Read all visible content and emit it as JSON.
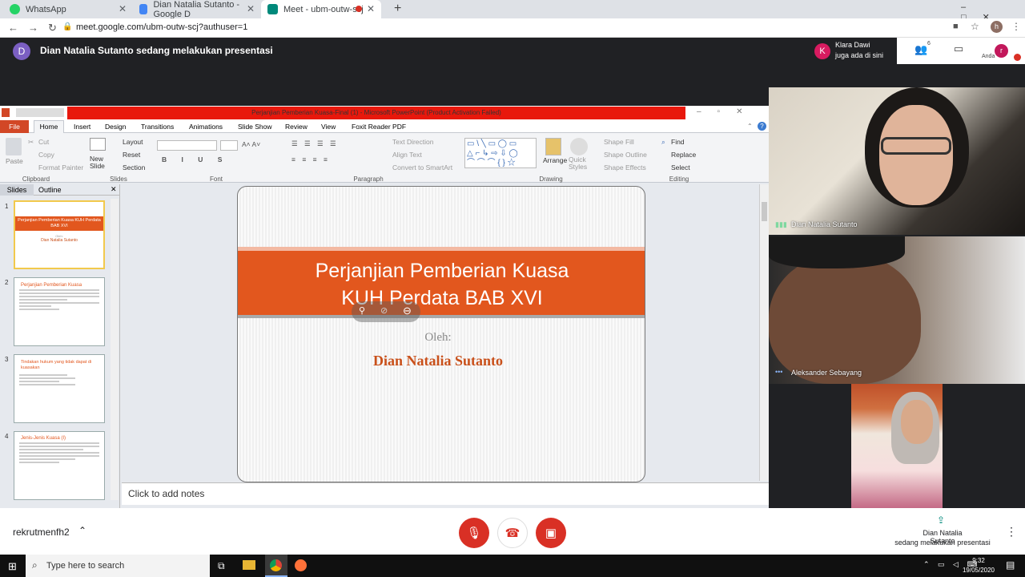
{
  "browser": {
    "tabs": [
      {
        "label": "WhatsApp",
        "color": "#25d366"
      },
      {
        "label": "Dian Natalia Sutanto - Google D",
        "color": "#4285f4"
      },
      {
        "label": "Meet - ubm-outw-scj",
        "color": "#00897b"
      }
    ],
    "url": "meet.google.com/ubm-outw-scj?authuser=1",
    "profile_initial": "h"
  },
  "meet": {
    "presenter_initial": "D",
    "presenting_text": "Dian Natalia Sutanto sedang melakukan presentasi",
    "notification": {
      "initial": "K",
      "name": "Klara Dawi",
      "text": "juga ada di sini"
    },
    "participants_count": "6",
    "you_label": "Anda",
    "you_initial": "r",
    "meeting_name": "rekrutmenfh2",
    "bottom_right": {
      "line1": "Dian Natalia Sutanto",
      "line2": "sedang melakukan presentasi"
    },
    "participants": [
      {
        "name": "Dian Natalia Sutanto"
      },
      {
        "name": "Aleksander Sebayang"
      }
    ]
  },
  "powerpoint": {
    "title": "Perjanjian Pemberian Kuasa-Final (1)  -  Microsoft PowerPoint (Product Activation Failed)",
    "file_tab": "File",
    "tabs": [
      "Home",
      "Insert",
      "Design",
      "Transitions",
      "Animations",
      "Slide Show",
      "Review",
      "View",
      "Foxit Reader PDF"
    ],
    "clipboard": {
      "paste": "Paste",
      "cut": "Cut",
      "copy": "Copy",
      "format_painter": "Format Painter",
      "group": "Clipboard"
    },
    "slides_group": {
      "new_slide": "New Slide",
      "layout": "Layout",
      "reset": "Reset",
      "section": "Section",
      "group": "Slides"
    },
    "groups": {
      "font": "Font",
      "paragraph": "Paragraph",
      "drawing": "Drawing",
      "editing": "Editing"
    },
    "paragraph": {
      "text_direction": "Text Direction",
      "align_text": "Align Text",
      "convert": "Convert to SmartArt"
    },
    "drawing": {
      "arrange": "Arrange",
      "quick_styles": "Quick Styles",
      "shape_fill": "Shape Fill",
      "shape_outline": "Shape Outline",
      "shape_effects": "Shape Effects"
    },
    "editing": {
      "find": "Find",
      "replace": "Replace",
      "select": "Select"
    },
    "panel_tabs": {
      "slides": "Slides",
      "outline": "Outline"
    },
    "thumbs": [
      {
        "num": "1",
        "title": "Perjanjian Pemberian Kuasa KUH Perdata  BAB XVI",
        "sub": "Oleh:",
        "author": "Dian Natalia Sutanto"
      },
      {
        "num": "2",
        "title": "Perjanjian Pemberian Kuasa"
      },
      {
        "num": "3",
        "title": "Tindakan hukum yang tidak dapat di kuasakan"
      },
      {
        "num": "4",
        "title": "Jenis-Jenis Kuasa (I)"
      }
    ],
    "slide": {
      "title_line1": "Perjanjian Pemberian Kuasa",
      "title_line2": "KUH Perdata  BAB XVI",
      "by": "Oleh:",
      "author": "Dian Natalia Sutanto",
      "accent": "#e2571e"
    },
    "notes_placeholder": "Click to add notes"
  },
  "taskbar": {
    "search_placeholder": "Type here to search",
    "time": "9:32",
    "date": "19/05/2020"
  }
}
